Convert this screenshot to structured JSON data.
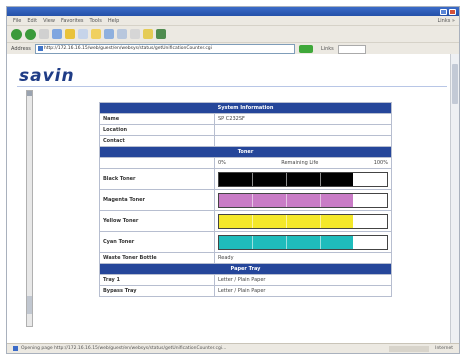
{
  "browser": {
    "menu_items": [
      "File",
      "Edit",
      "View",
      "Favorites",
      "Tools",
      "Help"
    ],
    "menu_right": "Links »",
    "address_label": "Address",
    "address_value": "http://172.16.16.15/web/guest/en/websys/status/getUnificationCounter.cgi",
    "links_label": "Links",
    "status_text": "Opening page http://172.16.16.15/web/guest/en/websys/status/getUnificationCounter.cgi...",
    "zone_text": "Internet"
  },
  "page": {
    "logo": "savin"
  },
  "sections": {
    "system_header": "System Information",
    "toner_header": "Toner",
    "paper_header": "Paper Tray"
  },
  "system": [
    {
      "label": "Name",
      "value": "SP C232SF"
    },
    {
      "label": "Location",
      "value": ""
    },
    {
      "label": "Contact",
      "value": ""
    }
  ],
  "toner_scale": {
    "min": "0%",
    "mid": "Remaining Life",
    "max": "100%"
  },
  "toner": [
    {
      "label": "Black Toner",
      "level": 80,
      "color": "#000000"
    },
    {
      "label": "Magenta Toner",
      "level": 80,
      "color": "#c97cc6"
    },
    {
      "label": "Yellow Toner",
      "level": 80,
      "color": "#f4e82a"
    },
    {
      "label": "Cyan Toner",
      "level": 80,
      "color": "#1fbcbc"
    }
  ],
  "waste": {
    "label": "Waste Toner Bottle",
    "value": "Ready"
  },
  "paper": [
    {
      "label": "Tray 1",
      "value": "Letter / Plain Paper"
    },
    {
      "label": "Bypass Tray",
      "value": "Letter / Plain Paper"
    }
  ]
}
